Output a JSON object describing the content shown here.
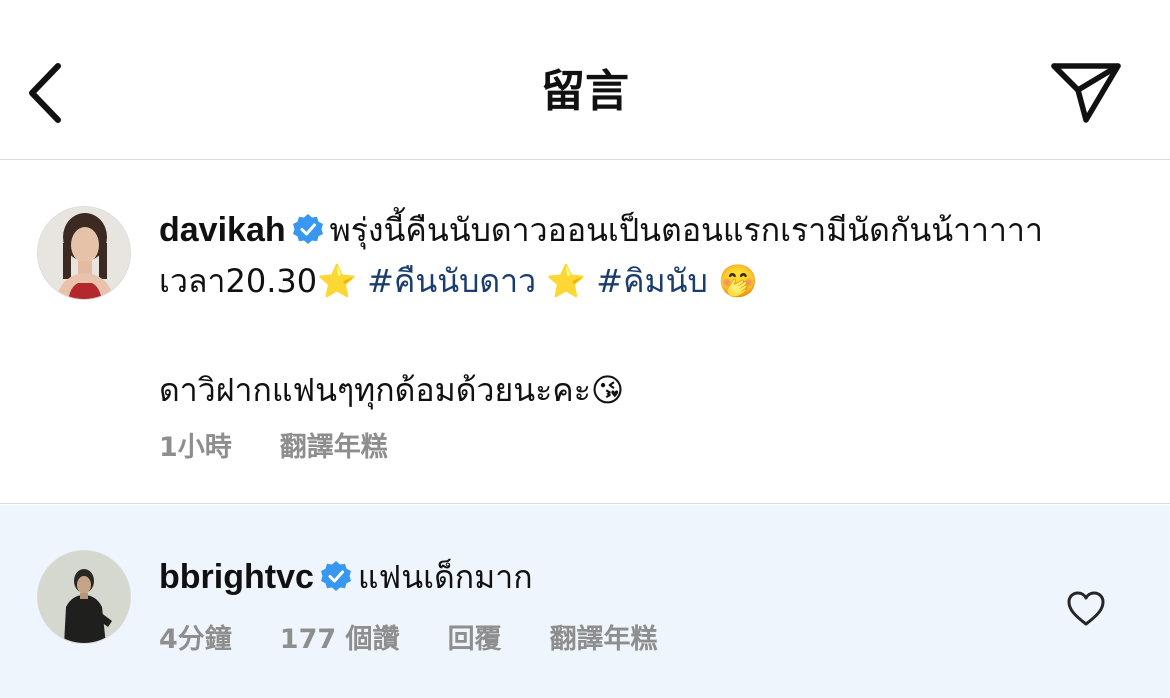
{
  "header": {
    "title": "留言"
  },
  "caption": {
    "username": "davikah",
    "text_line1": "พรุ่งนี้คืนนับดาวออนเป็นตอนแรกเรามีนัดกันน้าาาาา",
    "text_line2_pre": "เวลา20.30",
    "emoji_star": "⭐",
    "hashtag1": "#คืนนับดาว",
    "hashtag2": "#คิมนับ",
    "emoji_hand_over_mouth": "🤭",
    "text_para2": "ดาวิฝากแฟนๆทุกด้อมด้วยนะคะ",
    "emoji_kiss": "😘",
    "time": "1小時",
    "translate": "翻譯年糕"
  },
  "comment": {
    "username": "bbrightvc",
    "text": "แฟนเด็กมาก",
    "time": "4分鐘",
    "likes": "177 個讚",
    "reply": "回覆",
    "translate": "翻譯年糕"
  },
  "colors": {
    "verified_badge": "#3897f0",
    "hashtag": "#1b3d6e",
    "meta_gray": "#8e8e8e",
    "comment_bg": "#eff5fc",
    "divider": "#dbdbdb"
  },
  "icons": {
    "back": "chevron-left-icon",
    "share": "paper-plane-icon",
    "verified": "verified-badge-icon",
    "like": "heart-outline-icon"
  }
}
